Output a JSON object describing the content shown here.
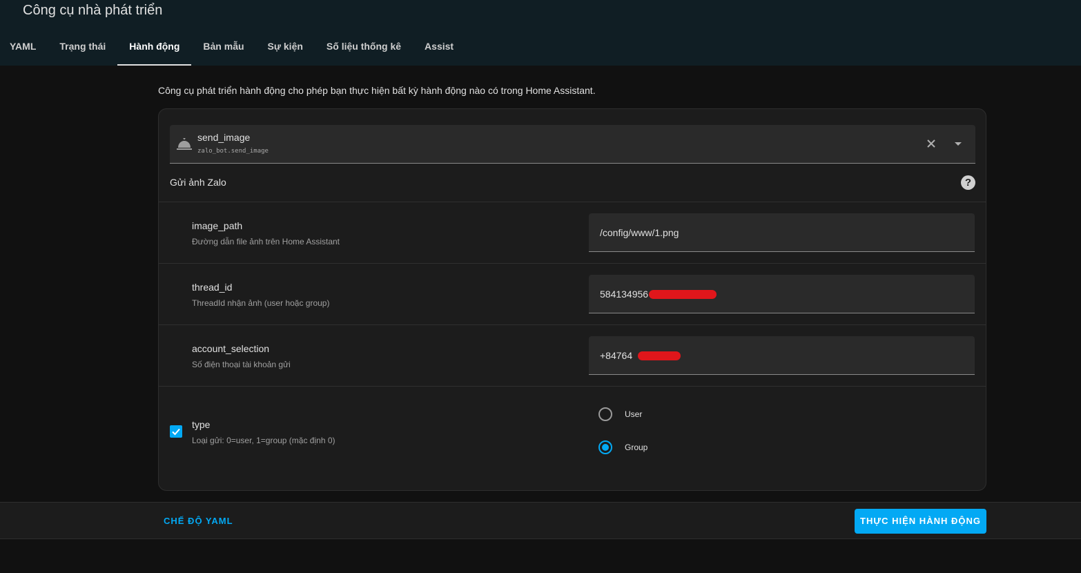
{
  "header": {
    "title": "Công cụ nhà phát triển",
    "tabs": [
      {
        "label": "YAML"
      },
      {
        "label": "Trạng thái"
      },
      {
        "label": "Hành động",
        "active": true
      },
      {
        "label": "Bản mẫu"
      },
      {
        "label": "Sự kiện"
      },
      {
        "label": "Số liệu thống kê"
      },
      {
        "label": "Assist"
      }
    ]
  },
  "main": {
    "description": "Công cụ phát triển hành động cho phép bạn thực hiện bất kỳ hành động nào có trong Home Assistant.",
    "action_picker": {
      "icon": "bell-service-icon",
      "name": "send_image",
      "id": "zalo_bot.send_image"
    },
    "service_name": "Gửi ảnh Zalo",
    "fields": [
      {
        "name": "image_path",
        "description": "Đường dẫn file ảnh trên Home Assistant",
        "value": "/config/www/1.png"
      },
      {
        "name": "thread_id",
        "description": "ThreadId nhận ảnh (user hoặc group)",
        "value": "584134956"
      },
      {
        "name": "account_selection",
        "description": "Số điện thoại tài khoản gửi",
        "value": "+84764"
      }
    ],
    "type_field": {
      "name": "type",
      "description": "Loại gửi: 0=user, 1=group (mặc định 0)",
      "enabled": true,
      "options": [
        {
          "label": "User",
          "selected": false
        },
        {
          "label": "Group",
          "selected": true
        }
      ]
    }
  },
  "footer": {
    "yaml_mode_label": "CHẾ ĐỘ YAML",
    "run_label": "THỰC HIỆN HÀNH ĐỘNG"
  },
  "colors": {
    "accent": "#03a9f4",
    "topbar": "#101e24",
    "redaction": "#e0161b"
  }
}
